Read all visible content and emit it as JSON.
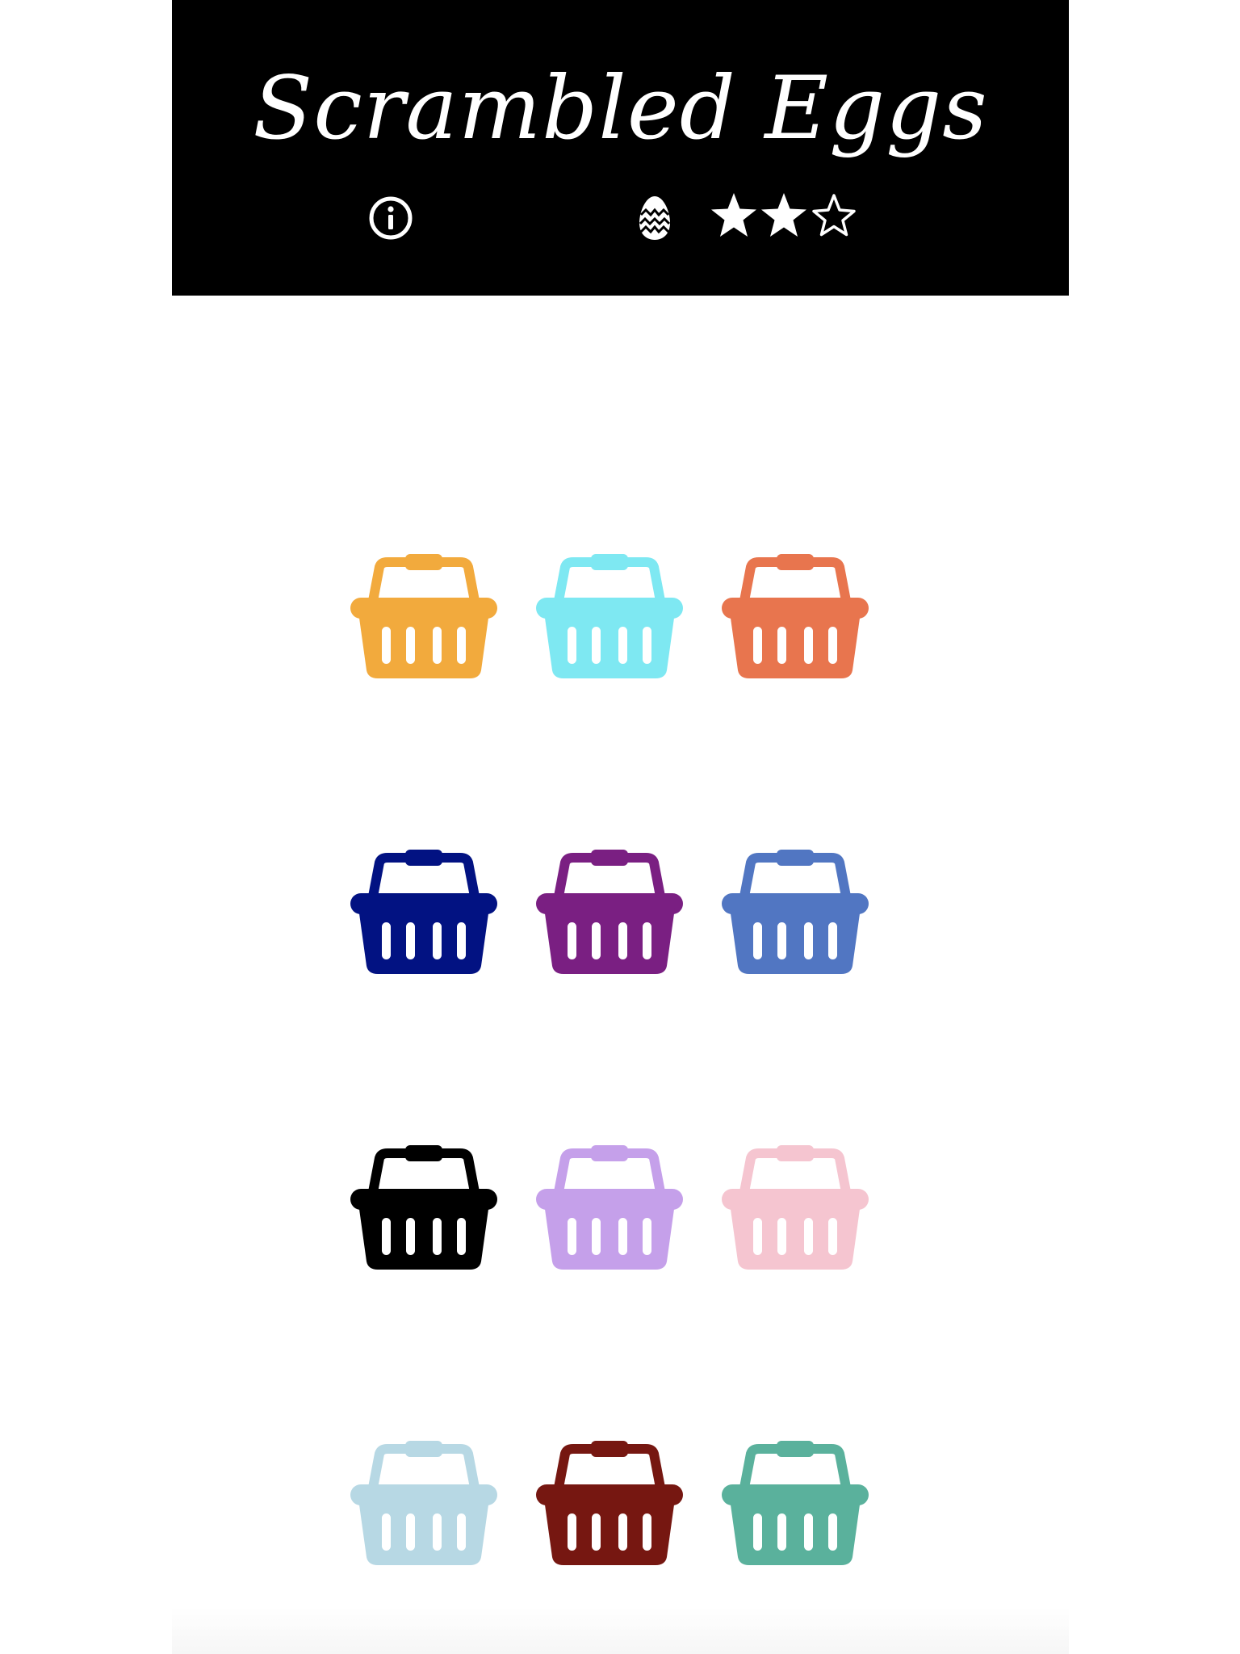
{
  "header": {
    "title": "Scrambled Eggs",
    "info_icon": "info-icon",
    "egg_icon": "egg-icon",
    "rating": {
      "value": 2,
      "max": 5
    }
  },
  "baskets": [
    {
      "color": "#F2AA3D"
    },
    {
      "color": "#7EE8F2"
    },
    {
      "color": "#E8754E"
    },
    {
      "color": "#021282"
    },
    {
      "color": "#7A1F82"
    },
    {
      "color": "#5176C2"
    },
    {
      "color": "#000000"
    },
    {
      "color": "#C5A0EA"
    },
    {
      "color": "#F5C5D0"
    },
    {
      "color": "#B7D8E4"
    },
    {
      "color": "#761711"
    },
    {
      "color": "#5AB19C"
    }
  ]
}
